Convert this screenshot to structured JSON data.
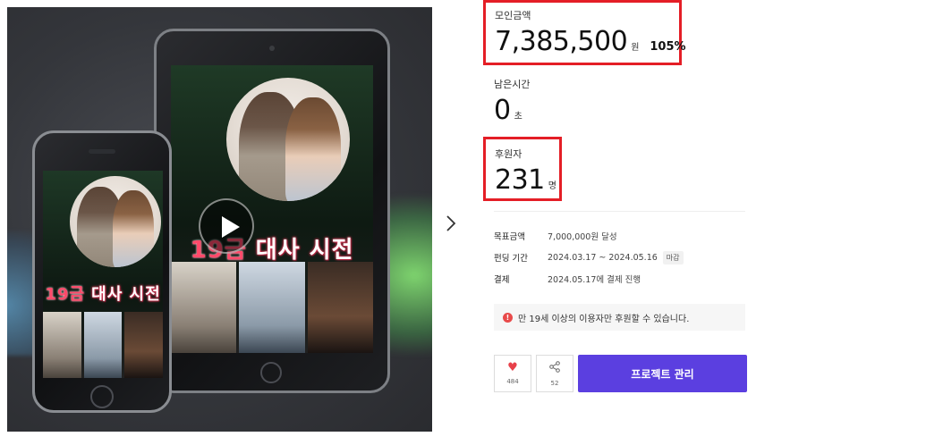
{
  "media": {
    "cover_title_main": "19금",
    "cover_title_rest": " 대사 시전",
    "next_icon": "chevron-right-icon",
    "play_icon": "play-icon"
  },
  "funding": {
    "amount_label": "모인금액",
    "amount_value": "7,385,500",
    "amount_unit": "원",
    "percent": "105%",
    "time_label": "남은시간",
    "time_value": "0",
    "time_unit": "초",
    "backers_label": "후원자",
    "backers_value": "231",
    "backers_unit": "명"
  },
  "details": {
    "goal_key": "목표금액",
    "goal_val": "7,000,000원 달성",
    "period_key": "펀딩 기간",
    "period_val": "2024.03.17 ~ 2024.05.16",
    "period_tag": "마감",
    "payment_key": "결제",
    "payment_val": "2024.05.17에 결제 진행"
  },
  "notice": {
    "icon": "warning-icon",
    "text": "만 19세 이상의 이용자만 후원할 수 있습니다."
  },
  "actions": {
    "like_count": "484",
    "share_count": "52",
    "manage_label": "프로젝트 관리"
  },
  "colors": {
    "highlight": "#e41e26",
    "primary": "#5b3fe0",
    "heart": "#e8414a"
  }
}
